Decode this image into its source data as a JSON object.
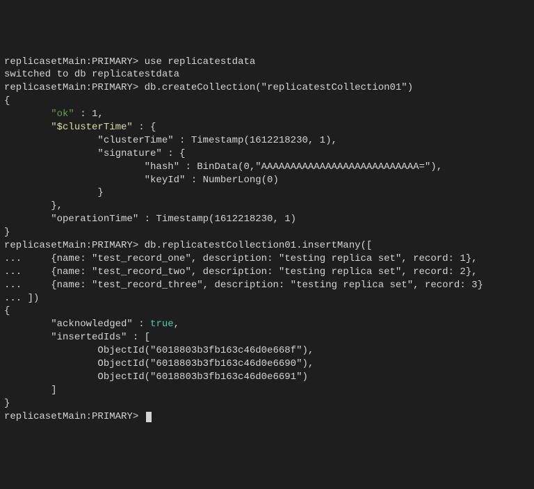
{
  "prompt": "replicasetMain:PRIMARY>",
  "continuation": "...",
  "cmd1": "use replicatestdata",
  "resp1": "switched to db replicatestdata",
  "cmd2": "db.createCollection(\"replicatestCollection01\")",
  "brace_open": "{",
  "brace_close": "}",
  "brace_close_comma": "},",
  "ok_key": "\"ok\"",
  "ok_val": " : 1,",
  "cluster_key": "\"$clusterTime\"",
  "cluster_open": " : {",
  "clusterTime_line": "                \"clusterTime\" : Timestamp(1612218230, 1),",
  "signature_line": "                \"signature\" : {",
  "hash_line": "                        \"hash\" : BinData(0,\"AAAAAAAAAAAAAAAAAAAAAAAAAAA=\"),",
  "keyId_line": "                        \"keyId\" : NumberLong(0)",
  "sig_close": "                }",
  "cluster_close": "        },",
  "opTime_line": "        \"operationTime\" : Timestamp(1612218230, 1)",
  "cmd3": "db.replicatestCollection01.insertMany([",
  "rec1": "     {name: \"test_record_one\", description: \"testing replica set\", record: 1},",
  "rec2": "     {name: \"test_record_two\", description: \"testing replica set\", record: 2},",
  "rec3": "     {name: \"test_record_three\", description: \"testing replica set\", record: 3}",
  "cmd3_close": " ])",
  "ack_key": "        \"acknowledged\" : ",
  "ack_val": "true",
  "ack_comma": ",",
  "ins_open": "        \"insertedIds\" : [",
  "oid1": "                ObjectId(\"6018803b3fb163c46d0e668f\"),",
  "oid2": "                ObjectId(\"6018803b3fb163c46d0e6690\"),",
  "oid3": "                ObjectId(\"6018803b3fb163c46d0e6691\")",
  "ins_close": "        ]",
  "indent8": "        "
}
